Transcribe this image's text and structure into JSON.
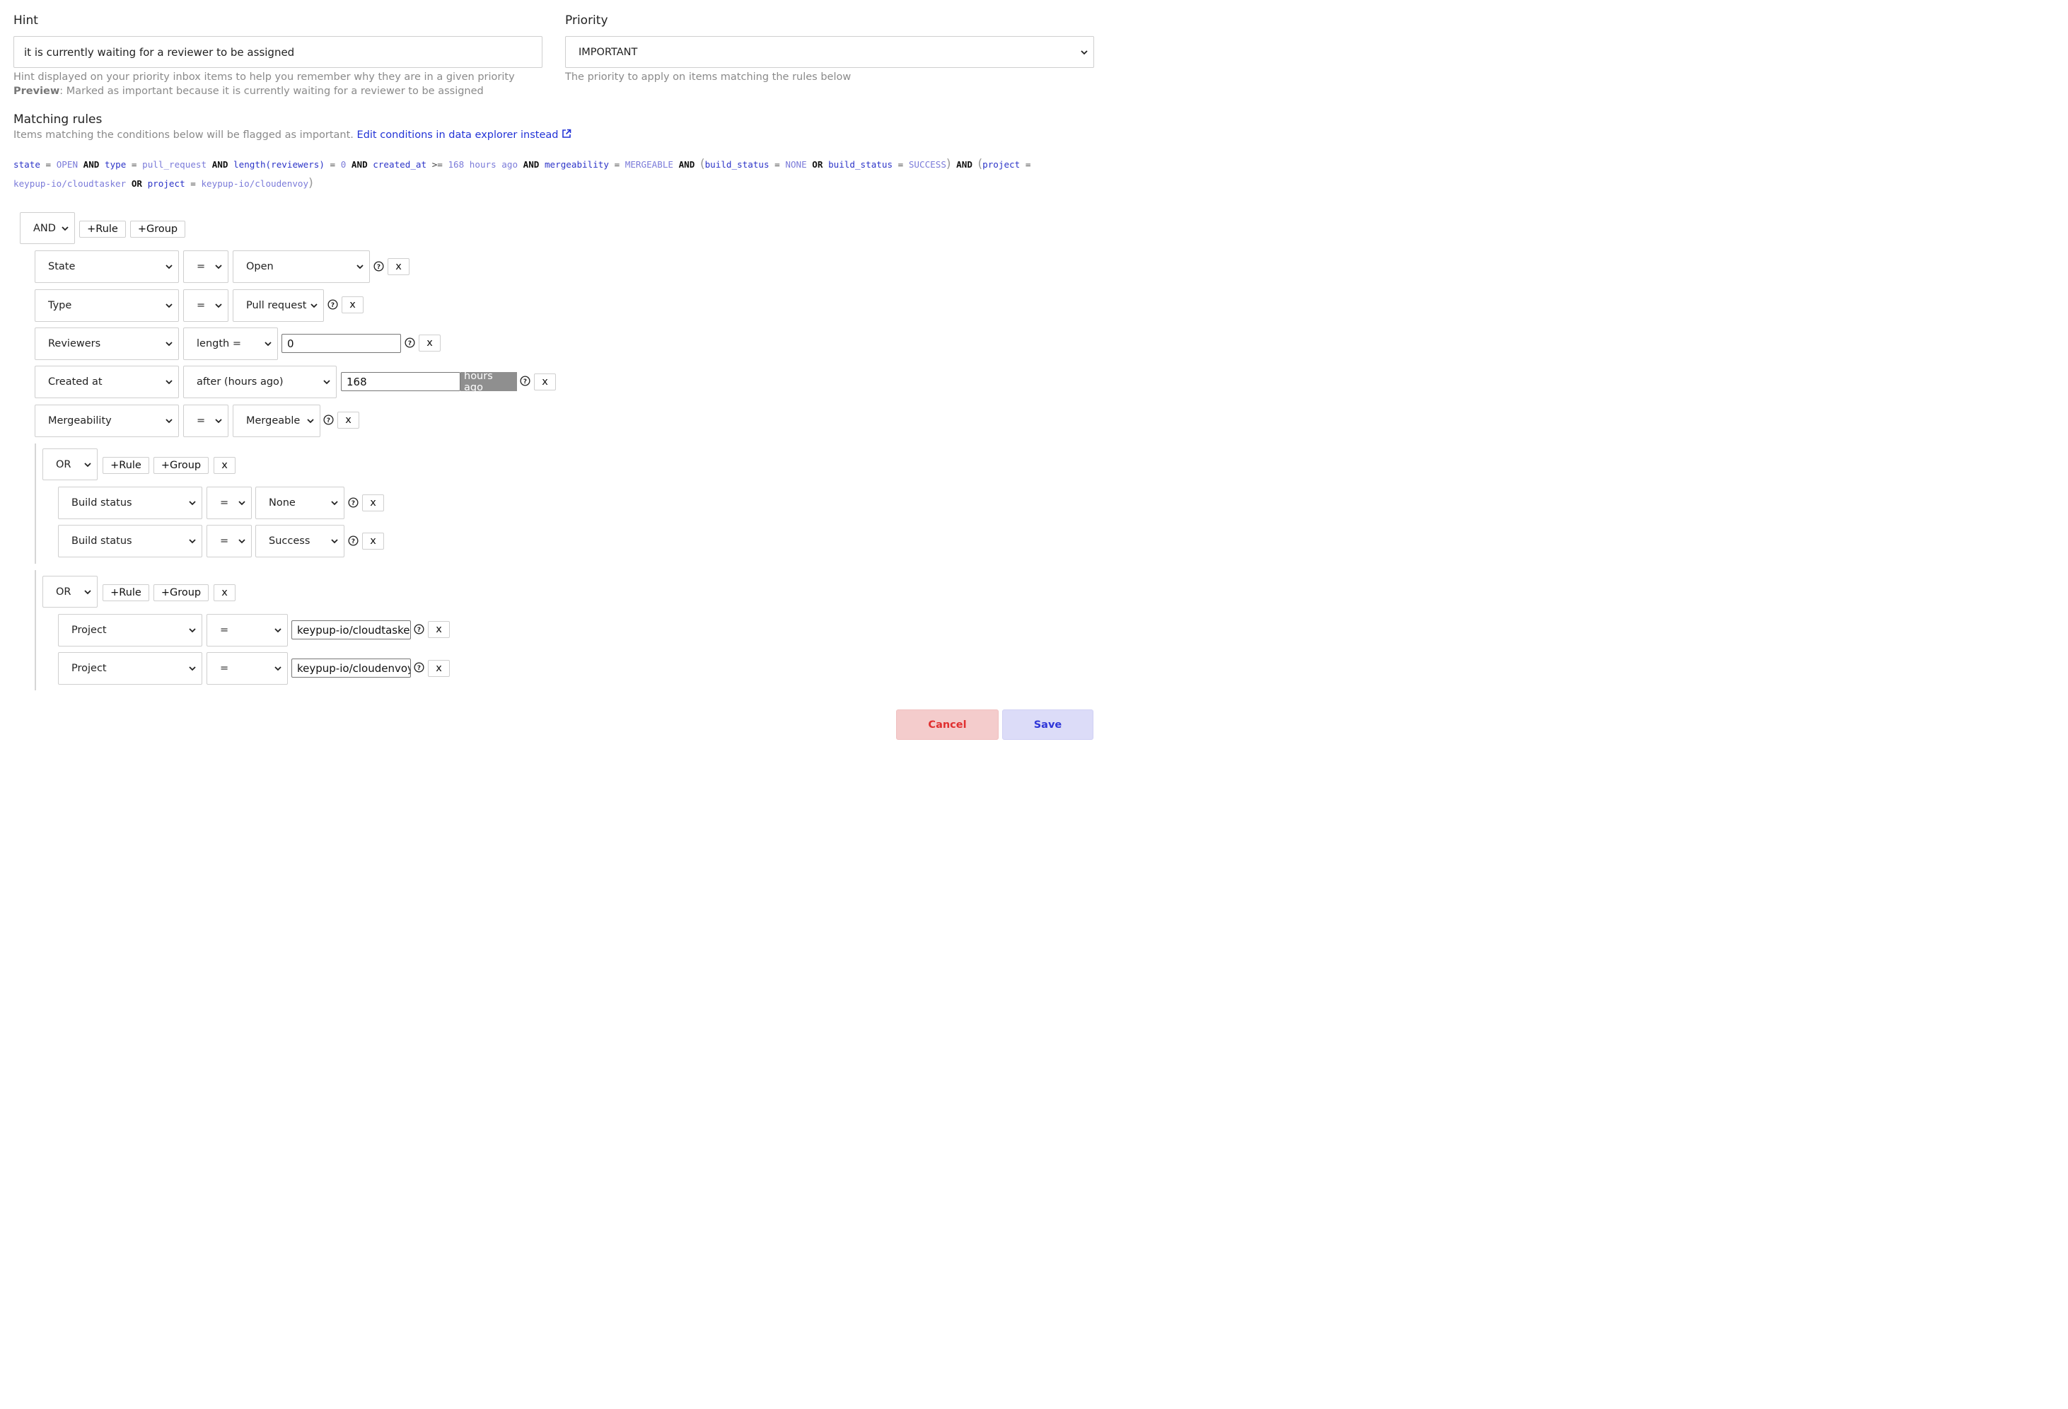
{
  "hint": {
    "label": "Hint",
    "value": "it is currently waiting for a reviewer to be assigned",
    "help": "Hint displayed on your priority inbox items to help you remember why they are in a given priority",
    "preview_label": "Preview",
    "preview_text": ": Marked as important because it is currently waiting for a reviewer to be assigned"
  },
  "priority": {
    "label": "Priority",
    "value": "IMPORTANT",
    "help": "The priority to apply on items matching the rules below"
  },
  "matching": {
    "title": "Matching rules",
    "desc": "Items matching the conditions below will be flagged as important.",
    "link": "Edit conditions in data explorer instead"
  },
  "query": {
    "t01": "state",
    "t02": "=",
    "t03": "OPEN",
    "t04": "AND",
    "t05": "type",
    "t06": "=",
    "t07": "pull_request",
    "t08": "AND",
    "t09": "length(reviewers)",
    "t10": "=",
    "t11": "0",
    "t12": "AND",
    "t13": "created_at",
    "t14": ">=",
    "t15": "168 hours ago",
    "t16": "AND",
    "t17": "mergeability",
    "t18": "=",
    "t19": "MERGEABLE",
    "t20": "AND",
    "t21": "(",
    "t22": "build_status",
    "t23": "=",
    "t24": "NONE",
    "t25": "OR",
    "t26": "build_status",
    "t27": "=",
    "t28": "SUCCESS",
    "t29": ")",
    "t30": "AND",
    "t31": "(",
    "t32": "project",
    "t33": "=",
    "t34": "keypup-io/cloudtasker",
    "t35": "OR",
    "t36": "project",
    "t37": "=",
    "t38": "keypup-io/cloudenvoy",
    "t39": ")"
  },
  "builder": {
    "combinator": "AND",
    "add_rule": "+Rule",
    "add_group": "+Group",
    "remove": "x",
    "rules": [
      {
        "field": "State",
        "op": "=",
        "value": "Open"
      },
      {
        "field": "Type",
        "op": "=",
        "value": "Pull request"
      },
      {
        "field": "Reviewers",
        "op": "length =",
        "value": "0"
      },
      {
        "field": "Created at",
        "op": "after (hours ago)",
        "value": "168",
        "suffix": "hours ago"
      },
      {
        "field": "Mergeability",
        "op": "=",
        "value": "Mergeable"
      }
    ],
    "groups": [
      {
        "combinator": "OR",
        "rules": [
          {
            "field": "Build status",
            "op": "=",
            "value": "None"
          },
          {
            "field": "Build status",
            "op": "=",
            "value": "Success"
          }
        ]
      },
      {
        "combinator": "OR",
        "rules": [
          {
            "field": "Project",
            "op": "=",
            "value": "keypup-io/cloudtasker"
          },
          {
            "field": "Project",
            "op": "=",
            "value": "keypup-io/cloudenvoy"
          }
        ]
      }
    ]
  },
  "actions": {
    "cancel": "Cancel",
    "save": "Save"
  }
}
